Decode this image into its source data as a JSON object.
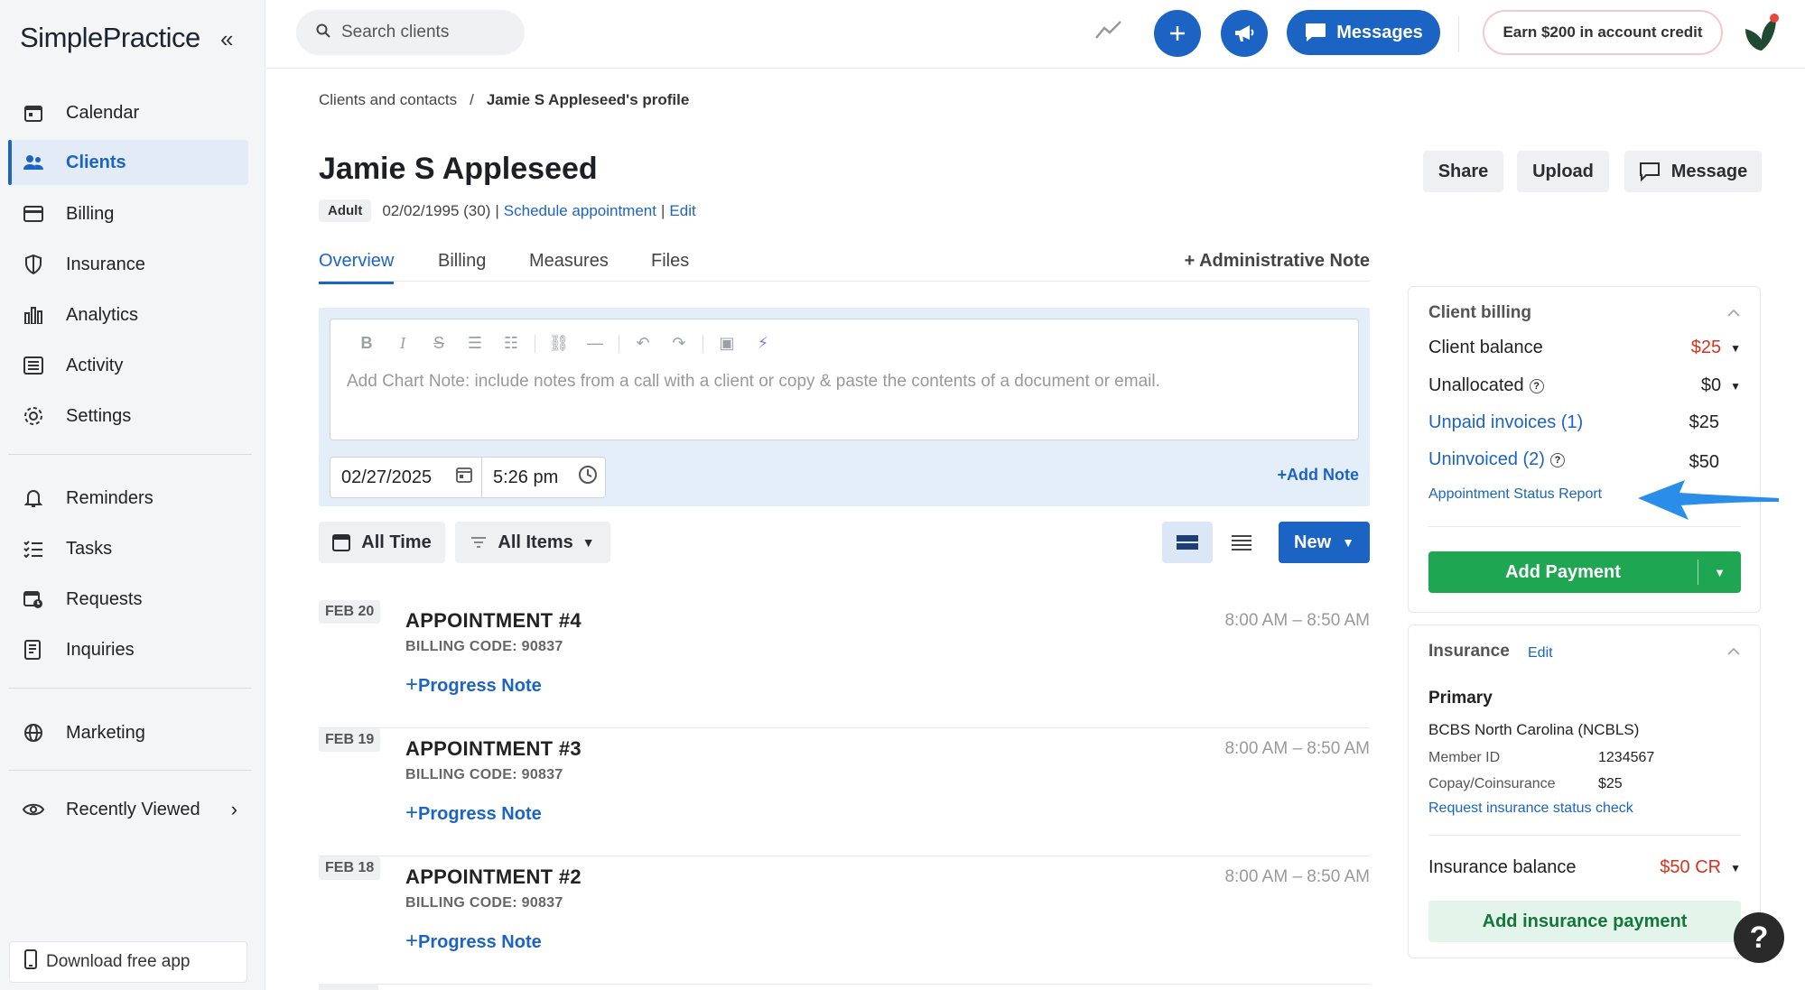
{
  "app": {
    "logo": "SimplePractice"
  },
  "sidebar": {
    "items": [
      {
        "label": "Calendar",
        "icon": "calendar-icon"
      },
      {
        "label": "Clients",
        "icon": "users-icon",
        "active": true
      },
      {
        "label": "Billing",
        "icon": "credit-card-icon"
      },
      {
        "label": "Insurance",
        "icon": "shield-icon"
      },
      {
        "label": "Analytics",
        "icon": "bar-chart-icon"
      },
      {
        "label": "Activity",
        "icon": "list-icon"
      },
      {
        "label": "Settings",
        "icon": "gear-icon"
      },
      {
        "label": "Reminders",
        "icon": "bell-icon"
      },
      {
        "label": "Tasks",
        "icon": "checklist-icon"
      },
      {
        "label": "Requests",
        "icon": "calendar-clock-icon"
      },
      {
        "label": "Inquiries",
        "icon": "document-list-icon"
      },
      {
        "label": "Marketing",
        "icon": "globe-icon"
      },
      {
        "label": "Recently Viewed",
        "icon": "eye-icon"
      }
    ],
    "download_label": "Download free app"
  },
  "topbar": {
    "search_placeholder": "Search clients",
    "messages_label": "Messages",
    "earn_label": "Earn $200 in account credit"
  },
  "breadcrumb": {
    "parent": "Clients and contacts",
    "separator": "/",
    "current": "Jamie S Appleseed's profile"
  },
  "client": {
    "name": "Jamie S Appleseed",
    "badge": "Adult",
    "dob": "02/02/1995 (30)",
    "divider": "|",
    "schedule_link": "Schedule appointment",
    "edit_link": "Edit"
  },
  "header_buttons": {
    "share": "Share",
    "upload": "Upload",
    "message": "Message"
  },
  "tabs": [
    {
      "label": "Overview",
      "active": true
    },
    {
      "label": "Billing"
    },
    {
      "label": "Measures"
    },
    {
      "label": "Files"
    }
  ],
  "admin_note_label": "+ Administrative Note",
  "editor": {
    "placeholder": "Add Chart Note: include notes from a call with a client or copy & paste the contents of a document or email.",
    "date": "02/27/2025",
    "time": "5:26 pm",
    "add_note_label": "+Add Note"
  },
  "filters": {
    "time_label": "All Time",
    "items_label": "All Items",
    "new_label": "New"
  },
  "appointments": [
    {
      "date": "FEB 20",
      "title": "APPOINTMENT #4",
      "code": "BILLING CODE: 90837",
      "time": "8:00 AM – 8:50 AM",
      "action": "Progress Note"
    },
    {
      "date": "FEB 19",
      "title": "APPOINTMENT #3",
      "code": "BILLING CODE: 90837",
      "time": "8:00 AM – 8:50 AM",
      "action": "Progress Note"
    },
    {
      "date": "FEB 18",
      "title": "APPOINTMENT #2",
      "code": "BILLING CODE: 90837",
      "time": "8:00 AM – 8:50 AM",
      "action": "Progress Note"
    }
  ],
  "client_billing": {
    "title": "Client billing",
    "balance_label": "Client balance",
    "balance_value": "$25",
    "unallocated_label": "Unallocated",
    "unallocated_value": "$0",
    "unpaid_label": "Unpaid invoices (1)",
    "unpaid_value": "$25",
    "uninvoiced_label": "Uninvoiced (2)",
    "uninvoiced_value": "$50",
    "report_link": "Appointment Status Report",
    "add_payment_label": "Add Payment"
  },
  "insurance": {
    "title": "Insurance",
    "edit_label": "Edit",
    "primary_label": "Primary",
    "payer": "BCBS North Carolina (NCBLS)",
    "member_id_label": "Member ID",
    "member_id_value": "1234567",
    "copay_label": "Copay/Coinsurance",
    "copay_value": "$25",
    "status_check_link": "Request insurance status check",
    "balance_label": "Insurance balance",
    "balance_value": "$50 CR",
    "add_payment_label": "Add insurance payment"
  },
  "help_label": "?",
  "colors": {
    "primary": "#1b64c4",
    "success": "#1fa652",
    "danger": "#d8321f",
    "arrow": "#2a8de8"
  }
}
